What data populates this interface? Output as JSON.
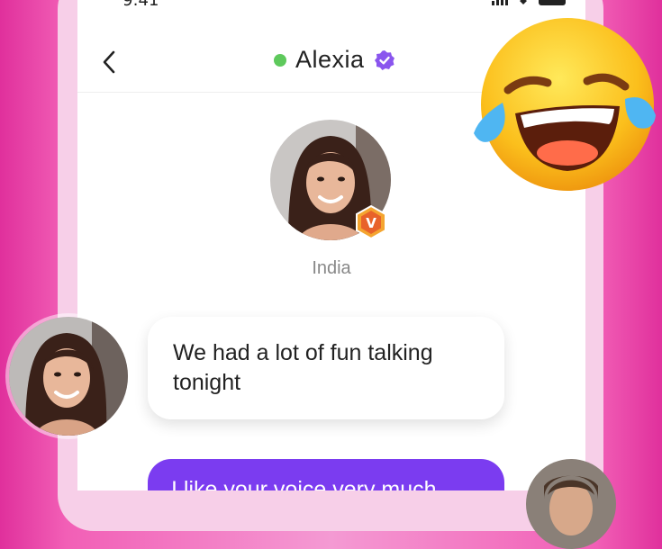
{
  "status_bar": {
    "time": "9:41"
  },
  "header": {
    "title": "Alexia",
    "online": true
  },
  "profile": {
    "country": "India",
    "badge_letter": "V"
  },
  "messages": [
    {
      "direction": "incoming",
      "text": "We had a lot of fun talking tonight"
    },
    {
      "direction": "outgoing",
      "text": "I like your voice very much"
    }
  ],
  "icons": {
    "back": "chevron-left-icon",
    "verified": "verified-badge-icon",
    "emoji": "laughing-tears-emoji"
  },
  "colors": {
    "accent": "#7b3cf0",
    "online": "#5ec95c",
    "verified": "#8a55ee",
    "background_pink": "#e0309c"
  }
}
